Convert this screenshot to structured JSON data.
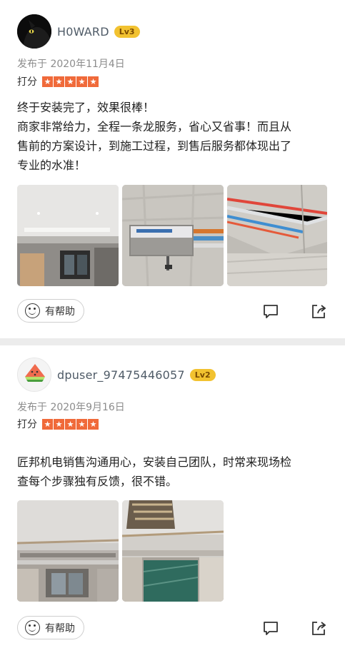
{
  "reviews": [
    {
      "username": "H0WARD",
      "level": "Lv3",
      "date": "发布于 2020年11月4日",
      "rating_label": "打分",
      "rating": 5,
      "text_lines": [
        "终于安装完了，效果很棒！",
        "商家非常给力，全程一条龙服务，省心又省事！而且从",
        "售前的方案设计，到施工过程，到售后服务都体现出了",
        "专业的水准！"
      ],
      "photos": [
        "room-ceiling-photo",
        "ac-unit-photo",
        "pipes-photo"
      ],
      "helpful_label": "有帮助"
    },
    {
      "username": "dpuser_97475446057",
      "level": "Lv2",
      "date": "发布于 2020年9月16日",
      "rating_label": "打分",
      "rating": 5,
      "text_lines": [
        "匠邦机电销售沟通用心，安装自己团队，时常来现场检",
        "查每个步骤独有反馈，很不错。"
      ],
      "photos": [
        "living-room-photo",
        "chandelier-room-photo"
      ],
      "helpful_label": "有帮助"
    }
  ],
  "colors": {
    "star": "#f06a3a",
    "level_badge": "#f2c230",
    "username": "#4f5b67"
  }
}
